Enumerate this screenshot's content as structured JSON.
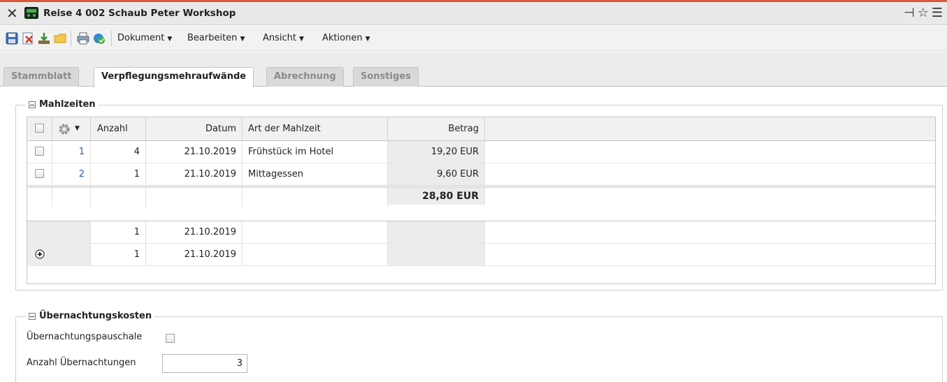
{
  "window": {
    "title": "Reise 4 002 Schaub Peter Workshop",
    "close_icon": "close-icon",
    "app_icon": "travel-icon",
    "right_icons": [
      "pin-icon",
      "star-icon",
      "menu-icon"
    ],
    "accent_color": "#d9573b"
  },
  "toolbar": {
    "icons": [
      "save-icon",
      "delete-icon",
      "download-icon",
      "folder-icon",
      "print-icon",
      "refresh-check-icon"
    ],
    "menus": [
      {
        "label": "Dokument"
      },
      {
        "label": "Bearbeiten"
      },
      {
        "label": "Ansicht"
      },
      {
        "label": "Aktionen"
      }
    ]
  },
  "tabs": [
    {
      "label": "Stammblatt",
      "active": false
    },
    {
      "label": "Verpflegungsmehraufwände",
      "active": true
    },
    {
      "label": "Abrechnung",
      "active": false
    },
    {
      "label": "Sonstiges",
      "active": false
    }
  ],
  "meals": {
    "legend": "Mahlzeiten",
    "columns": {
      "anzahl": "Anzahl",
      "datum": "Datum",
      "art": "Art der Mahlzeit",
      "betrag": "Betrag"
    },
    "rows": [
      {
        "nr": "1",
        "anzahl": "4",
        "datum": "21.10.2019",
        "art": "Frühstück im Hotel",
        "betrag": "19,20 EUR",
        "checked": false
      },
      {
        "nr": "2",
        "anzahl": "1",
        "datum": "21.10.2019",
        "art": "Mittagessen",
        "betrag": "9,60 EUR",
        "checked": false
      }
    ],
    "total": "28,80 EUR",
    "new_rows": [
      {
        "anzahl": "1",
        "datum": "21.10.2019"
      },
      {
        "anzahl": "1",
        "datum": "21.10.2019"
      }
    ]
  },
  "lodging": {
    "legend": "Übernachtungskosten",
    "pauschale_label": "Übernachtungspauschale",
    "pauschale_checked": false,
    "count_label": "Anzahl Übernachtungen",
    "count_value": "3"
  }
}
